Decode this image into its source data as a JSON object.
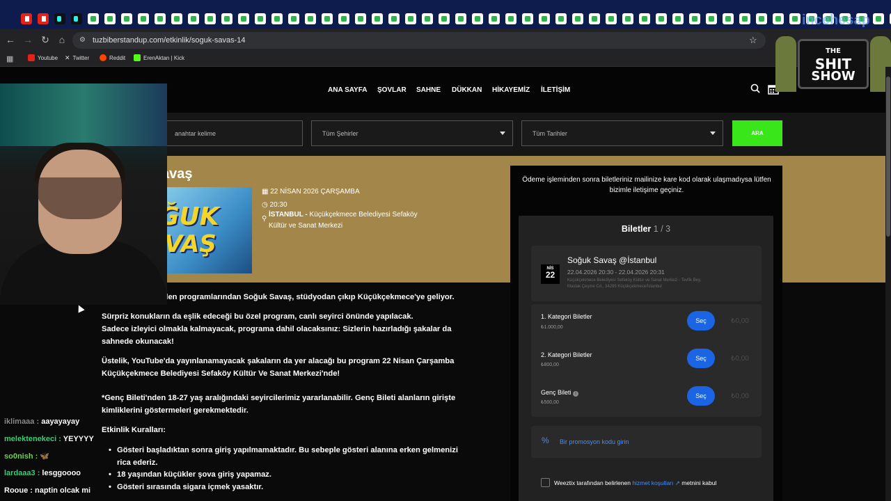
{
  "browser": {
    "url": "tuzbiberstandup.com/etkinlik/soguk-savas-14",
    "bookmarks": [
      "Youtube",
      "Twitter",
      "Reddit",
      "ErenAktan | Kick"
    ],
    "overlay_brand": "incehesap"
  },
  "site": {
    "nav": [
      "ANA SAYFA",
      "ŞOVLAR",
      "SAHNE",
      "DÜKKAN",
      "HİKAYEMİZ",
      "İLETİŞİM"
    ],
    "search_placeholder": "anahtar kelime",
    "city_select": "Tüm Şehirler",
    "date_select": "Tüm Tarihler",
    "search_button": "ARA"
  },
  "event": {
    "title_partial": "avaş",
    "poster_text_1": "ĞUK",
    "poster_text_2": "VAŞ",
    "date": "22 NİSAN 2026 ÇARŞAMBA",
    "time": "20:30",
    "city": "İSTANBUL -",
    "venue_line1": "Küçükçekmece Belediyesi Sefaköy",
    "venue_line2": "Kültür ve Sanat Merkezi"
  },
  "description": {
    "p1": "vilen programlarından Soğuk Savaş, stüdyodan çıkıp Küçükçekmece'ye geliyor.",
    "p2_l1": "Sürpriz konukların da eşlik edeceği bu özel program, canlı seyirci önünde yapılacak.",
    "p2_l2": "Sadece izleyici olmakla kalmayacak, programa dahil olacaksınız: Sizlerin hazırladığı şakalar da",
    "p2_l3": "sahnede okunacak!",
    "p3_l1": "Üstelik, YouTube'da yayınlanamayacak şakaların da yer alacağı bu program 22 Nisan Çarşamba",
    "p3_l2": "Küçükçekmece Belediyesi Sefaköy Kültür Ve Sanat Merkezi'nde!",
    "p4_l1": "*Genç Bileti'nden 18-27 yaş aralığındaki seyircilerimiz yararlanabilir. Genç Bileti alanların girişte",
    "p4_l2": "kimliklerini göstermeleri gerekmektedir.",
    "rules_heading": "Etkinlik Kuralları:",
    "rule1_l1": "Gösteri başladıktan sonra giriş yapılmamaktadır. Bu sebeple gösteri alanına erken gelmenizi",
    "rule1_l2": "rica ederiz.",
    "rule2": "18 yaşından küçükler şova giriş yapamaz.",
    "rule3": "Gösteri sırasında sigara içmek yasaktır."
  },
  "sidebar": {
    "notice": "Ödeme işleminden sonra biletleriniz mailinize kare kod olarak ulaşmadıysa lütfen bizimle iletişime geçiniz.",
    "heading": "Biletler",
    "step": "1 / 3",
    "card_title": "Soğuk Savaş @İstanbul",
    "card_dates": "22.04.2026 20:30 - 22.04.2026 20:31",
    "card_address_l1": "Küçükçekmece Belediyesi Sefaköy Kültür ve Sanat Merkezi - Tevfik Bey,",
    "card_address_l2": "Maslak Çeşme Cd., 34295 Küçükçekmece/İstanbul",
    "badge_month": "NİS",
    "badge_day": "22",
    "tickets": [
      {
        "name": "1. Kategori Biletler",
        "price": "₺1.000,00",
        "button": "Seç",
        "amount": "₺0,00"
      },
      {
        "name": "2. Kategori Biletler",
        "price": "₺800,00",
        "button": "Seç",
        "amount": "₺0,00"
      },
      {
        "name": "Genç Bileti",
        "price": "₺500,00",
        "button": "Seç",
        "amount": "₺0,00"
      }
    ],
    "promo": "Bir promosyon kodu girin",
    "terms_pre": "Weeztix tarafından belirlenen",
    "terms_link": "hizmet koşulları",
    "terms_post": "metnini kabul"
  },
  "chat": [
    {
      "user": "iklimaaa",
      "msg": "aayayayay",
      "color": "#8b8b8b"
    },
    {
      "user": "melektenekeci",
      "msg": "YEYYYY",
      "color": "#3ad17a"
    },
    {
      "user": "so0nish",
      "msg": "🦋",
      "color": "#6fd84b"
    },
    {
      "user": "lardaaa3",
      "msg": "lesggoooo",
      "color": "#3ad17a"
    },
    {
      "user": "Rooue",
      "msg": "naptin olcak mi",
      "color": "#ffffff"
    }
  ],
  "overlay_logo": {
    "line1": "THE",
    "line2": "SHIT",
    "line3": "SHOW"
  },
  "colors": {
    "accent_green": "#39e619",
    "banner_gold": "#a3874a",
    "select_blue": "#1b64e3"
  }
}
